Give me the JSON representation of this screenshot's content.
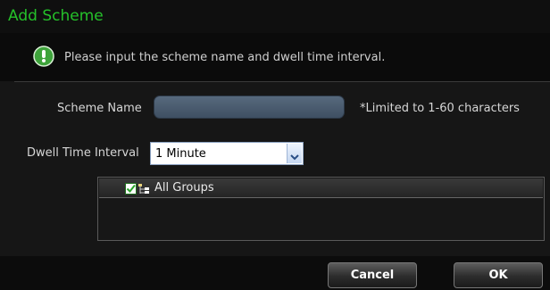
{
  "dialog": {
    "title": "Add Scheme",
    "info_message": "Please input the scheme name and dwell time interval.",
    "colors": {
      "title": "#25c12a",
      "info_icon": "#3ea33b"
    }
  },
  "form": {
    "scheme_name_label": "Scheme Name",
    "scheme_name_value": "",
    "scheme_name_hint": "*Limited to 1-60 characters",
    "dwell_label": "Dwell Time Interval",
    "dwell_selected": "1 Minute"
  },
  "groups": {
    "items": [
      {
        "label": "All Groups",
        "checked": true,
        "icon": "group-tree-icon"
      }
    ]
  },
  "buttons": {
    "cancel": "Cancel",
    "ok": "OK"
  }
}
